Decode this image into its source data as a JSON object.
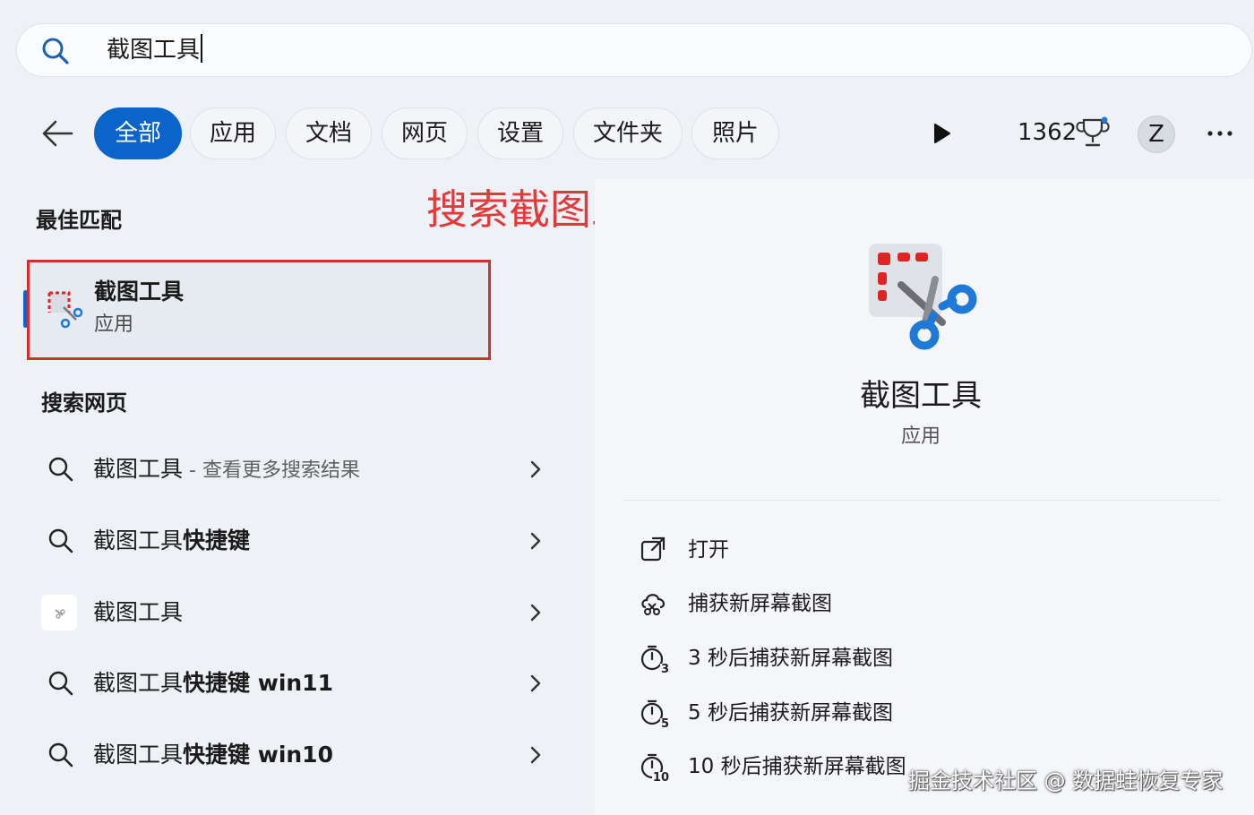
{
  "search": {
    "query": "截图工具"
  },
  "filters": [
    {
      "label": "全部",
      "active": true
    },
    {
      "label": "应用",
      "active": false
    },
    {
      "label": "文档",
      "active": false
    },
    {
      "label": "网页",
      "active": false
    },
    {
      "label": "设置",
      "active": false
    },
    {
      "label": "文件夹",
      "active": false
    },
    {
      "label": "照片",
      "active": false
    }
  ],
  "account": {
    "points": "1362",
    "avatar_initial": "Z"
  },
  "annotation": "搜索截图工具并打开",
  "best_match": {
    "section_title": "最佳匹配",
    "name": "截图工具",
    "type": "应用"
  },
  "web_search": {
    "section_title": "搜索网页",
    "items": [
      {
        "prefix": "截图工具",
        "bold": "",
        "suffix": " - 查看更多搜索结果",
        "icon": "search-icon"
      },
      {
        "prefix": "截图工具",
        "bold": "快捷键",
        "suffix": "",
        "icon": "search-icon"
      },
      {
        "prefix": "截图工具",
        "bold": "",
        "suffix": "",
        "icon": "app-thumbnail"
      },
      {
        "prefix": "截图工具",
        "bold": "快捷键 win11",
        "suffix": "",
        "icon": "search-icon"
      },
      {
        "prefix": "截图工具",
        "bold": "快捷键 win10",
        "suffix": "",
        "icon": "search-icon"
      }
    ]
  },
  "details": {
    "name": "截图工具",
    "type": "应用",
    "actions": [
      {
        "label": "打开",
        "icon": "open-external-icon"
      },
      {
        "label": "捕获新屏幕截图",
        "icon": "capture-icon"
      },
      {
        "label": "3 秒后捕获新屏幕截图",
        "icon": "timer-3-icon",
        "digit": "3"
      },
      {
        "label": "5 秒后捕获新屏幕截图",
        "icon": "timer-5-icon",
        "digit": "5"
      },
      {
        "label": "10 秒后捕获新屏幕截图",
        "icon": "timer-10-icon",
        "digit": "10"
      }
    ]
  },
  "watermark": "掘金技术社区 @ 数据蛙恢复专家",
  "colors": {
    "accent": "#0a64c9",
    "annotation_red": "#e23a3a",
    "highlight_border": "#d32f2f",
    "snip_red": "#e02424",
    "snip_blue": "#1e7ad6"
  }
}
